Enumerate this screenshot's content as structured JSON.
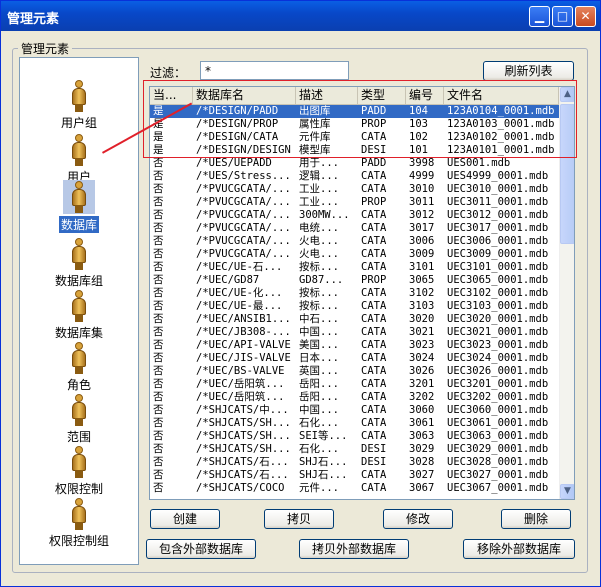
{
  "window": {
    "title": "管理元素",
    "minimize_icon": "minimize-icon",
    "maximize_icon": "maximize-icon",
    "close_icon": "close-icon"
  },
  "group": {
    "label": "管理元素"
  },
  "nav": [
    {
      "label": "用户组",
      "icon": "person-icon"
    },
    {
      "label": "用户",
      "icon": "person-icon"
    },
    {
      "label": "数据库",
      "icon": "person-icon",
      "selected": true
    },
    {
      "label": "数据库组",
      "icon": "person-icon"
    },
    {
      "label": "数据库集",
      "icon": "person-icon"
    },
    {
      "label": "角色",
      "icon": "person-icon"
    },
    {
      "label": "范围",
      "icon": "person-icon"
    },
    {
      "label": "权限控制",
      "icon": "person-icon"
    },
    {
      "label": "权限控制组",
      "icon": "person-icon"
    }
  ],
  "filter": {
    "label": "过滤：",
    "value": "*"
  },
  "refresh_label": "刷新列表",
  "table": {
    "columns": [
      "当...",
      "数据库名",
      "描述",
      "类型",
      "编号",
      "文件名"
    ],
    "rows": [
      [
        "是",
        "/*DESIGN/PADD",
        "出图库",
        "PADD",
        "104",
        "123A0104_0001.mdb"
      ],
      [
        "是",
        "/*DESIGN/PROP",
        "属性库",
        "PROP",
        "103",
        "123A0103_0001.mdb"
      ],
      [
        "是",
        "/*DESIGN/CATA",
        "元件库",
        "CATA",
        "102",
        "123A0102_0001.mdb"
      ],
      [
        "是",
        "/*DESIGN/DESIGN",
        "模型库",
        "DESI",
        "101",
        "123A0101_0001.mdb"
      ],
      [
        "否",
        "/*UES/UEPADD",
        "用于...",
        "PADD",
        "3998",
        "UES001.mdb"
      ],
      [
        "否",
        "/*UES/Stress...",
        "逻辑...",
        "CATA",
        "4999",
        "UES4999_0001.mdb"
      ],
      [
        "否",
        "/*PVUCGCATA/...",
        "工业...",
        "CATA",
        "3010",
        "UEC3010_0001.mdb"
      ],
      [
        "否",
        "/*PVUCGCATA/...",
        "工业...",
        "PROP",
        "3011",
        "UEC3011_0001.mdb"
      ],
      [
        "否",
        "/*PVUCGCATA/...",
        "300MW...",
        "CATA",
        "3012",
        "UEC3012_0001.mdb"
      ],
      [
        "否",
        "/*PVUCGCATA/...",
        "电统...",
        "CATA",
        "3017",
        "UEC3017_0001.mdb"
      ],
      [
        "否",
        "/*PVUCGCATA/...",
        "火电...",
        "CATA",
        "3006",
        "UEC3006_0001.mdb"
      ],
      [
        "否",
        "/*PVUCGCATA/...",
        "火电...",
        "CATA",
        "3009",
        "UEC3009_0001.mdb"
      ],
      [
        "否",
        "/*UEC/UE-石...",
        "按标...",
        "CATA",
        "3101",
        "UEC3101_0001.mdb"
      ],
      [
        "否",
        "/*UEC/GD87",
        "GD87...",
        "PROP",
        "3065",
        "UEC3065_0001.mdb"
      ],
      [
        "否",
        "/*UEC/UE-化...",
        "按标...",
        "CATA",
        "3102",
        "UEC3102_0001.mdb"
      ],
      [
        "否",
        "/*UEC/UE-最...",
        "按标...",
        "CATA",
        "3103",
        "UEC3103_0001.mdb"
      ],
      [
        "否",
        "/*UEC/ANSIB1...",
        "中石...",
        "CATA",
        "3020",
        "UEC3020_0001.mdb"
      ],
      [
        "否",
        "/*UEC/JB308-...",
        "中国...",
        "CATA",
        "3021",
        "UEC3021_0001.mdb"
      ],
      [
        "否",
        "/*UEC/API-VALVE",
        "美国...",
        "CATA",
        "3023",
        "UEC3023_0001.mdb"
      ],
      [
        "否",
        "/*UEC/JIS-VALVE",
        "日本...",
        "CATA",
        "3024",
        "UEC3024_0001.mdb"
      ],
      [
        "否",
        "/*UEC/BS-VALVE",
        "英国...",
        "CATA",
        "3026",
        "UEC3026_0001.mdb"
      ],
      [
        "否",
        "/*UEC/岳阳筑...",
        "岳阳...",
        "CATA",
        "3201",
        "UEC3201_0001.mdb"
      ],
      [
        "否",
        "/*UEC/岳阳筑...",
        "岳阳...",
        "CATA",
        "3202",
        "UEC3202_0001.mdb"
      ],
      [
        "否",
        "/*SHJCATS/中...",
        "中国...",
        "CATA",
        "3060",
        "UEC3060_0001.mdb"
      ],
      [
        "否",
        "/*SHJCATS/SH...",
        "石化...",
        "CATA",
        "3061",
        "UEC3061_0001.mdb"
      ],
      [
        "否",
        "/*SHJCATS/SH...",
        "SEI等...",
        "CATA",
        "3063",
        "UEC3063_0001.mdb"
      ],
      [
        "否",
        "/*SHJCATS/SH...",
        "石化...",
        "DESI",
        "3029",
        "UEC3029_0001.mdb"
      ],
      [
        "否",
        "/*SHJCATS/石...",
        "SHJ石...",
        "DESI",
        "3028",
        "UEC3028_0001.mdb"
      ],
      [
        "否",
        "/*SHJCATS/石...",
        "SHJ石...",
        "CATA",
        "3027",
        "UEC3027_0001.mdb"
      ],
      [
        "否",
        "/*SHJCATS/COCO",
        "元件...",
        "CATA",
        "3067",
        "UEC3067_0001.mdb"
      ]
    ]
  },
  "buttons": {
    "create": "创建",
    "copy": "拷贝",
    "modify": "修改",
    "delete": "删除",
    "include_external": "包含外部数据库",
    "copy_external": "拷贝外部数据库",
    "remove_external": "移除外部数据库"
  },
  "scroll_up_icon": "scroll-up-icon",
  "scroll_down_icon": "scroll-down-icon",
  "annotation_color": "#e0202a",
  "selection_color": "#316ac5"
}
